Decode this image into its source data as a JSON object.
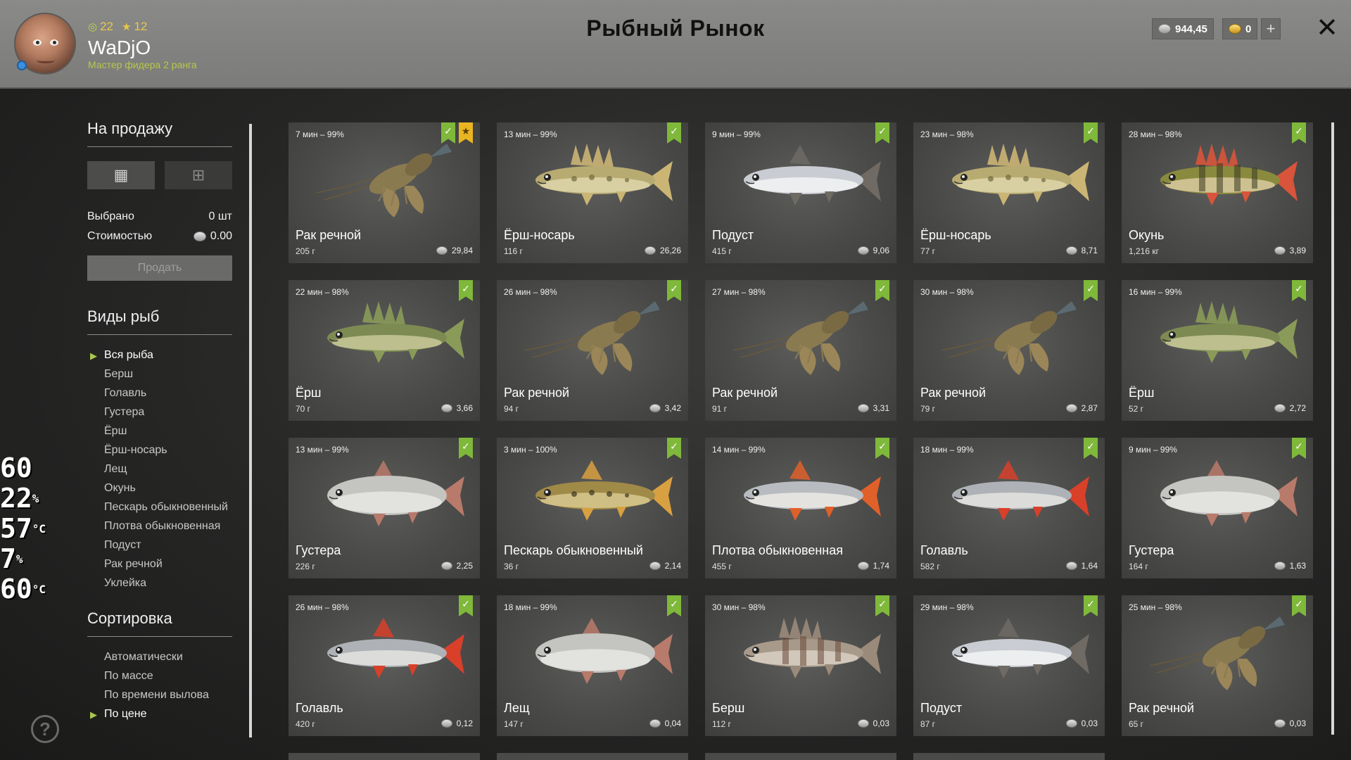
{
  "header": {
    "title": "Рыбный Рынок",
    "player": {
      "name": "WaDjO",
      "rank": "Мастер фидера 2 ранга",
      "level": "22",
      "stars": "12"
    },
    "currency": {
      "silver": "944,45",
      "gold": "0"
    }
  },
  "sidebar": {
    "for_sale_title": "На продажу",
    "selected_label": "Выбрано",
    "selected_value": "0 шт",
    "cost_label": "Стоимостью",
    "cost_value": "0.00",
    "sell_button": "Продать",
    "fish_types_title": "Виды рыб",
    "fish_types": [
      {
        "label": "Вся рыба",
        "active": true
      },
      {
        "label": "Берш",
        "active": false
      },
      {
        "label": "Голавль",
        "active": false
      },
      {
        "label": "Густера",
        "active": false
      },
      {
        "label": "Ёрш",
        "active": false
      },
      {
        "label": "Ёрш-носарь",
        "active": false
      },
      {
        "label": "Лещ",
        "active": false
      },
      {
        "label": "Окунь",
        "active": false
      },
      {
        "label": "Пескарь обыкновенный",
        "active": false
      },
      {
        "label": "Плотва обыкновенная",
        "active": false
      },
      {
        "label": "Подуст",
        "active": false
      },
      {
        "label": "Рак речной",
        "active": false
      },
      {
        "label": "Уклейка",
        "active": false
      }
    ],
    "sort_title": "Сортировка",
    "sort_options": [
      {
        "label": "Автоматически",
        "active": false
      },
      {
        "label": "По массе",
        "active": false
      },
      {
        "label": "По времени вылова",
        "active": false
      },
      {
        "label": "По цене",
        "active": true
      }
    ]
  },
  "fps_overlay": [
    "60",
    "22",
    "57",
    "7",
    "60"
  ],
  "fps_units": [
    "",
    "%",
    "°C",
    "%",
    "°C"
  ],
  "fish_cards": [
    {
      "time": "7 мин – 99%",
      "name": "Рак речной",
      "weight": "205 г",
      "price": "29,84",
      "icon": "crayfish",
      "starred": true
    },
    {
      "time": "13 мин – 99%",
      "name": "Ёрш-носарь",
      "weight": "116 г",
      "price": "26,26",
      "icon": "zander-fish",
      "starred": false
    },
    {
      "time": "9 мин – 99%",
      "name": "Подуст",
      "weight": "415 г",
      "price": "9,06",
      "icon": "silver-fish",
      "starred": false
    },
    {
      "time": "23 мин – 98%",
      "name": "Ёрш-носарь",
      "weight": "77 г",
      "price": "8,71",
      "icon": "zander-fish",
      "starred": false
    },
    {
      "time": "28 мин – 98%",
      "name": "Окунь",
      "weight": "1,216 кг",
      "price": "3,89",
      "icon": "perch-fish",
      "starred": false
    },
    {
      "time": "22 мин – 98%",
      "name": "Ёрш",
      "weight": "70 г",
      "price": "3,66",
      "icon": "ruffe-fish",
      "starred": false
    },
    {
      "time": "26 мин – 98%",
      "name": "Рак речной",
      "weight": "94 г",
      "price": "3,42",
      "icon": "crayfish",
      "starred": false
    },
    {
      "time": "27 мин – 98%",
      "name": "Рак речной",
      "weight": "91 г",
      "price": "3,31",
      "icon": "crayfish",
      "starred": false
    },
    {
      "time": "30 мин – 98%",
      "name": "Рак речной",
      "weight": "79 г",
      "price": "2,87",
      "icon": "crayfish",
      "starred": false
    },
    {
      "time": "16 мин – 99%",
      "name": "Ёрш",
      "weight": "52 г",
      "price": "2,72",
      "icon": "ruffe-fish",
      "starred": false
    },
    {
      "time": "13 мин – 99%",
      "name": "Густера",
      "weight": "226 г",
      "price": "2,25",
      "icon": "bream-fish",
      "starred": false
    },
    {
      "time": "3 мин – 100%",
      "name": "Пескарь обыкновенный",
      "weight": "36 г",
      "price": "2,14",
      "icon": "gudgeon-fish",
      "starred": false
    },
    {
      "time": "14 мин – 99%",
      "name": "Плотва обыкновенная",
      "weight": "455 г",
      "price": "1,74",
      "icon": "roach-fish",
      "starred": false
    },
    {
      "time": "18 мин – 99%",
      "name": "Голавль",
      "weight": "582 г",
      "price": "1,64",
      "icon": "chub-fish",
      "starred": false
    },
    {
      "time": "9 мин – 99%",
      "name": "Густера",
      "weight": "164 г",
      "price": "1,63",
      "icon": "bream-fish",
      "starred": false
    },
    {
      "time": "26 мин – 98%",
      "name": "Голавль",
      "weight": "420 г",
      "price": "0,12",
      "icon": "chub-fish",
      "starred": false
    },
    {
      "time": "18 мин – 99%",
      "name": "Лещ",
      "weight": "147 г",
      "price": "0,04",
      "icon": "bream-fish",
      "starred": false
    },
    {
      "time": "30 мин – 98%",
      "name": "Берш",
      "weight": "112 г",
      "price": "0,03",
      "icon": "bersh-fish",
      "starred": false
    },
    {
      "time": "29 мин – 98%",
      "name": "Подуст",
      "weight": "87 г",
      "price": "0,03",
      "icon": "silver-fish",
      "starred": false
    },
    {
      "time": "25 мин – 98%",
      "name": "Рак речной",
      "weight": "65 г",
      "price": "0,03",
      "icon": "crayfish",
      "starred": false
    }
  ],
  "colors": {
    "accent_green": "#7fb83a",
    "star_gold": "#e9b520",
    "rank_text": "#b8c84a"
  }
}
